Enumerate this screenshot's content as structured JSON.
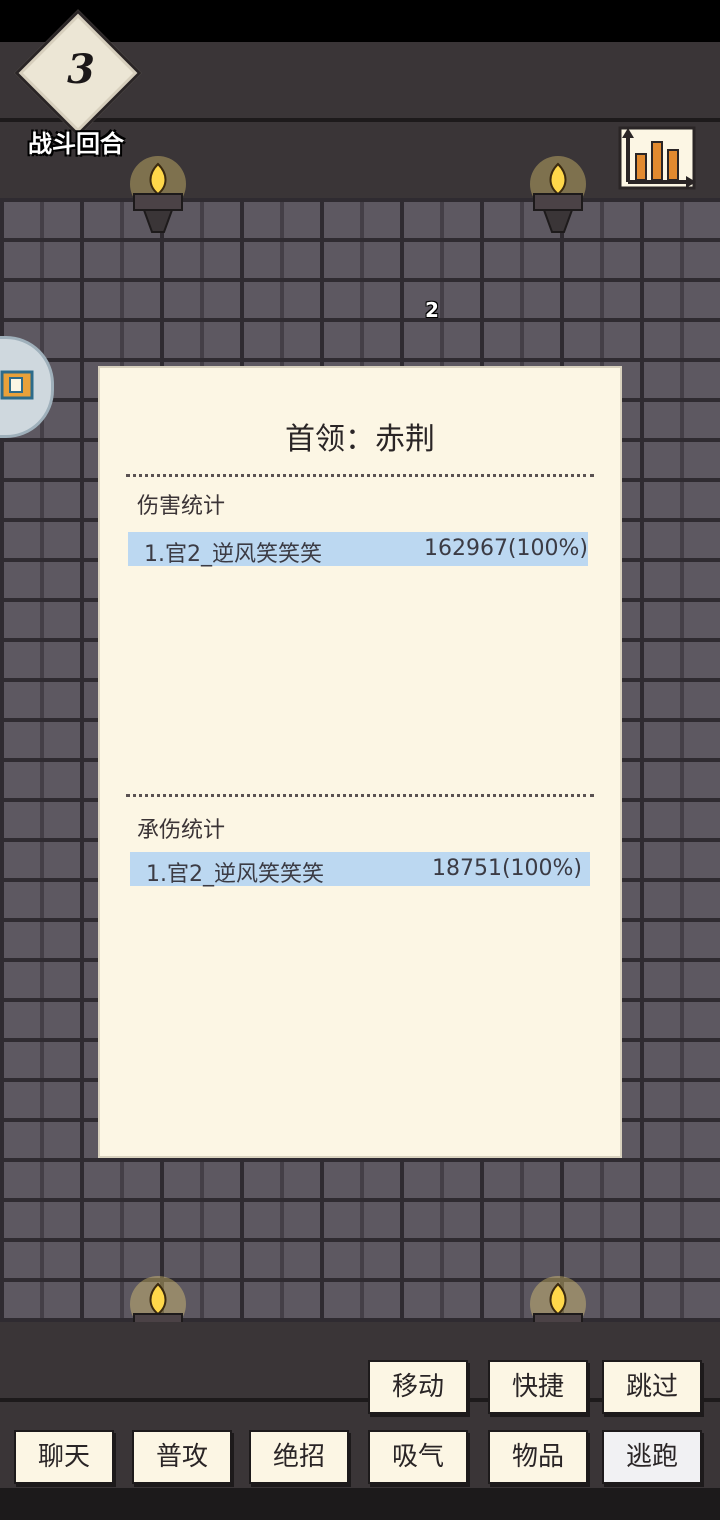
{
  "header": {
    "round_number": "3",
    "round_label": "战斗回合",
    "stats_icon": "bar-chart-icon"
  },
  "arena": {
    "turn_count": "2",
    "side_tab_icon": "side-panel-icon"
  },
  "panel": {
    "title": "首领：赤荆",
    "damage_section": {
      "label": "伤害统计",
      "rows": [
        {
          "name": "1.官2_逆风笑笑笑",
          "value": "162967(100%)"
        }
      ]
    },
    "taken_section": {
      "label": "承伤统计",
      "rows": [
        {
          "name": "1.官2_逆风笑笑笑",
          "value": "18751(100%)"
        }
      ]
    }
  },
  "actions": {
    "row1": [
      "移动",
      "快捷",
      "跳过"
    ],
    "row2": [
      "聊天",
      "普攻",
      "绝招",
      "吸气",
      "物品",
      "逃跑"
    ]
  },
  "colors": {
    "panel_bg": "#fcf6e4",
    "highlight_row": "#bcd8f1",
    "wall": "#5d5861",
    "flame": "#ffd84a"
  }
}
